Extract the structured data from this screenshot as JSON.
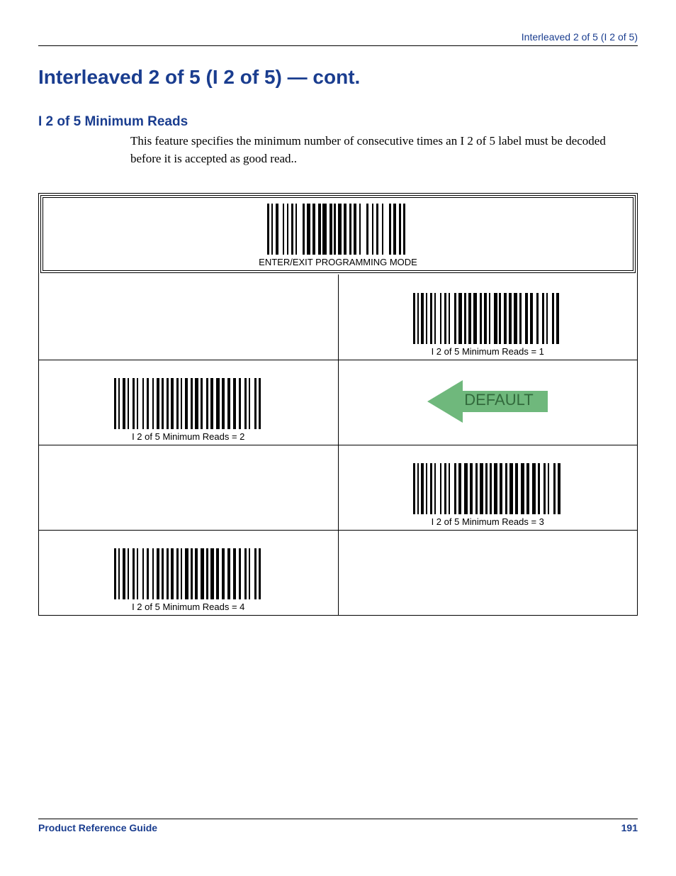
{
  "header": {
    "running_head": "Interleaved 2 of 5 (I 2 of 5)"
  },
  "title": "Interleaved 2 of 5 (I 2 of 5) — cont.",
  "section": {
    "heading": "I 2 of 5 Minimum Reads",
    "body": "This feature specifies the minimum number of consecutive times an I 2 of 5 label must be decoded before it is accepted as good read.."
  },
  "programming_barcode_label": "ENTER/EXIT PROGRAMMING MODE",
  "default_label": "DEFAULT",
  "options": [
    {
      "label": "I 2 of  5 Minimum Reads = 1",
      "column": "right"
    },
    {
      "label": "I 2 of  5 Minimum Reads = 2",
      "column": "left",
      "is_default": true
    },
    {
      "label": "I 2 of  5 Minimum Reads = 3",
      "column": "right"
    },
    {
      "label": "I 2 of  5 Minimum Reads = 4",
      "column": "left"
    }
  ],
  "footer": {
    "left": "Product Reference Guide",
    "page": "191"
  }
}
